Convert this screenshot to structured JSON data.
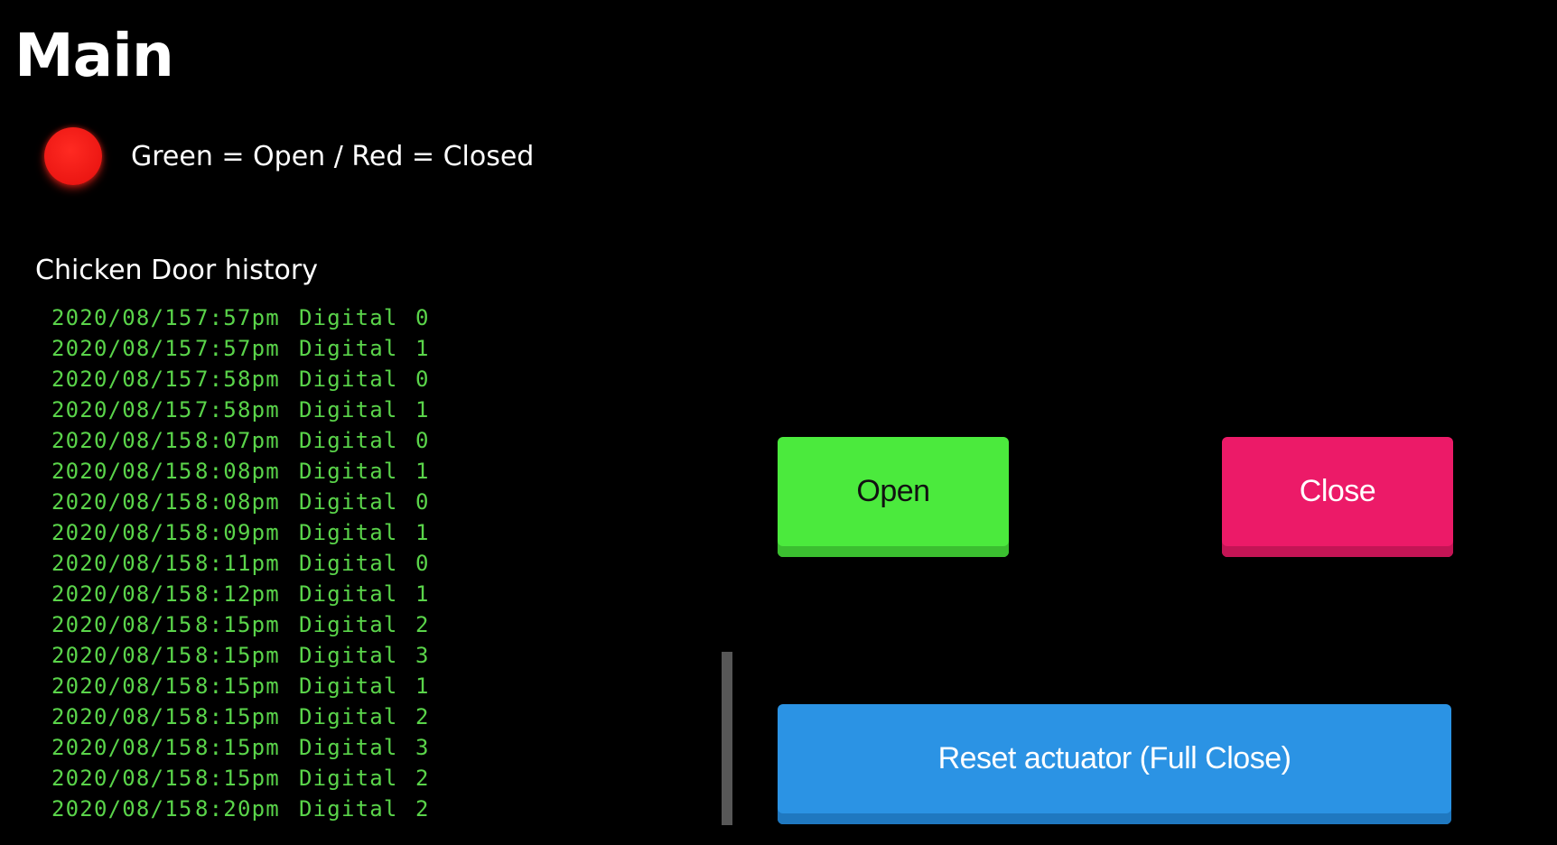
{
  "page": {
    "title": "Main"
  },
  "status": {
    "indicator_color": "#ec1713",
    "indicator_state": "Closed",
    "legend": "Green = Open / Red = Closed"
  },
  "history": {
    "title": "Chicken Door history",
    "text_color": "#5ad44a",
    "entries": [
      {
        "date": "2020/08/15",
        "time": "7:57pm",
        "type": "Digital",
        "value": "0"
      },
      {
        "date": "2020/08/15",
        "time": "7:57pm",
        "type": "Digital",
        "value": "1"
      },
      {
        "date": "2020/08/15",
        "time": "7:58pm",
        "type": "Digital",
        "value": "0"
      },
      {
        "date": "2020/08/15",
        "time": "7:58pm",
        "type": "Digital",
        "value": "1"
      },
      {
        "date": "2020/08/15",
        "time": "8:07pm",
        "type": "Digital",
        "value": "0"
      },
      {
        "date": "2020/08/15",
        "time": "8:08pm",
        "type": "Digital",
        "value": "1"
      },
      {
        "date": "2020/08/15",
        "time": "8:08pm",
        "type": "Digital",
        "value": "0"
      },
      {
        "date": "2020/08/15",
        "time": "8:09pm",
        "type": "Digital",
        "value": "1"
      },
      {
        "date": "2020/08/15",
        "time": "8:11pm",
        "type": "Digital",
        "value": "0"
      },
      {
        "date": "2020/08/15",
        "time": "8:12pm",
        "type": "Digital",
        "value": "1"
      },
      {
        "date": "2020/08/15",
        "time": "8:15pm",
        "type": "Digital",
        "value": "2"
      },
      {
        "date": "2020/08/15",
        "time": "8:15pm",
        "type": "Digital",
        "value": "3"
      },
      {
        "date": "2020/08/15",
        "time": "8:15pm",
        "type": "Digital",
        "value": "1"
      },
      {
        "date": "2020/08/15",
        "time": "8:15pm",
        "type": "Digital",
        "value": "2"
      },
      {
        "date": "2020/08/15",
        "time": "8:15pm",
        "type": "Digital",
        "value": "3"
      },
      {
        "date": "2020/08/15",
        "time": "8:15pm",
        "type": "Digital",
        "value": "2"
      },
      {
        "date": "2020/08/15",
        "time": "8:20pm",
        "type": "Digital",
        "value": "2"
      }
    ]
  },
  "controls": {
    "open_label": "Open",
    "open_color": "#4bea3d",
    "close_label": "Close",
    "close_color": "#ec1a68",
    "reset_label": "Reset actuator (Full Close)",
    "reset_color": "#2b93e4"
  }
}
